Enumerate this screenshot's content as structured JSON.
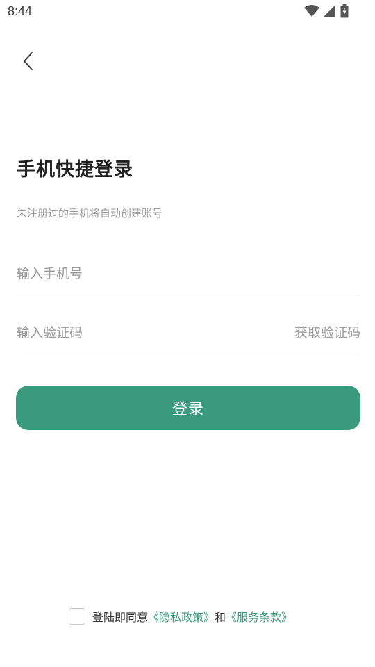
{
  "status_bar": {
    "time": "8:44",
    "icons": [
      "wifi-icon",
      "cellular-signal-icon",
      "battery-charging-icon"
    ]
  },
  "nav": {
    "back_icon": "chevron-left-icon"
  },
  "header": {
    "title": "手机快捷登录",
    "subtitle": "未注册过的手机将自动创建账号"
  },
  "form": {
    "phone_placeholder": "输入手机号",
    "phone_value": "",
    "code_placeholder": "输入验证码",
    "code_value": "",
    "get_code_label": "获取验证码"
  },
  "login_button": {
    "label": "登录"
  },
  "agreement": {
    "prefix": "登陆即同意",
    "privacy_link": "《隐私政策》",
    "connector": "和",
    "terms_link": "《服务条款》",
    "checked": false
  },
  "colors": {
    "accent": "#3a9a7c",
    "title": "#222222",
    "muted": "#9a9a9a",
    "divider": "#ececec"
  }
}
